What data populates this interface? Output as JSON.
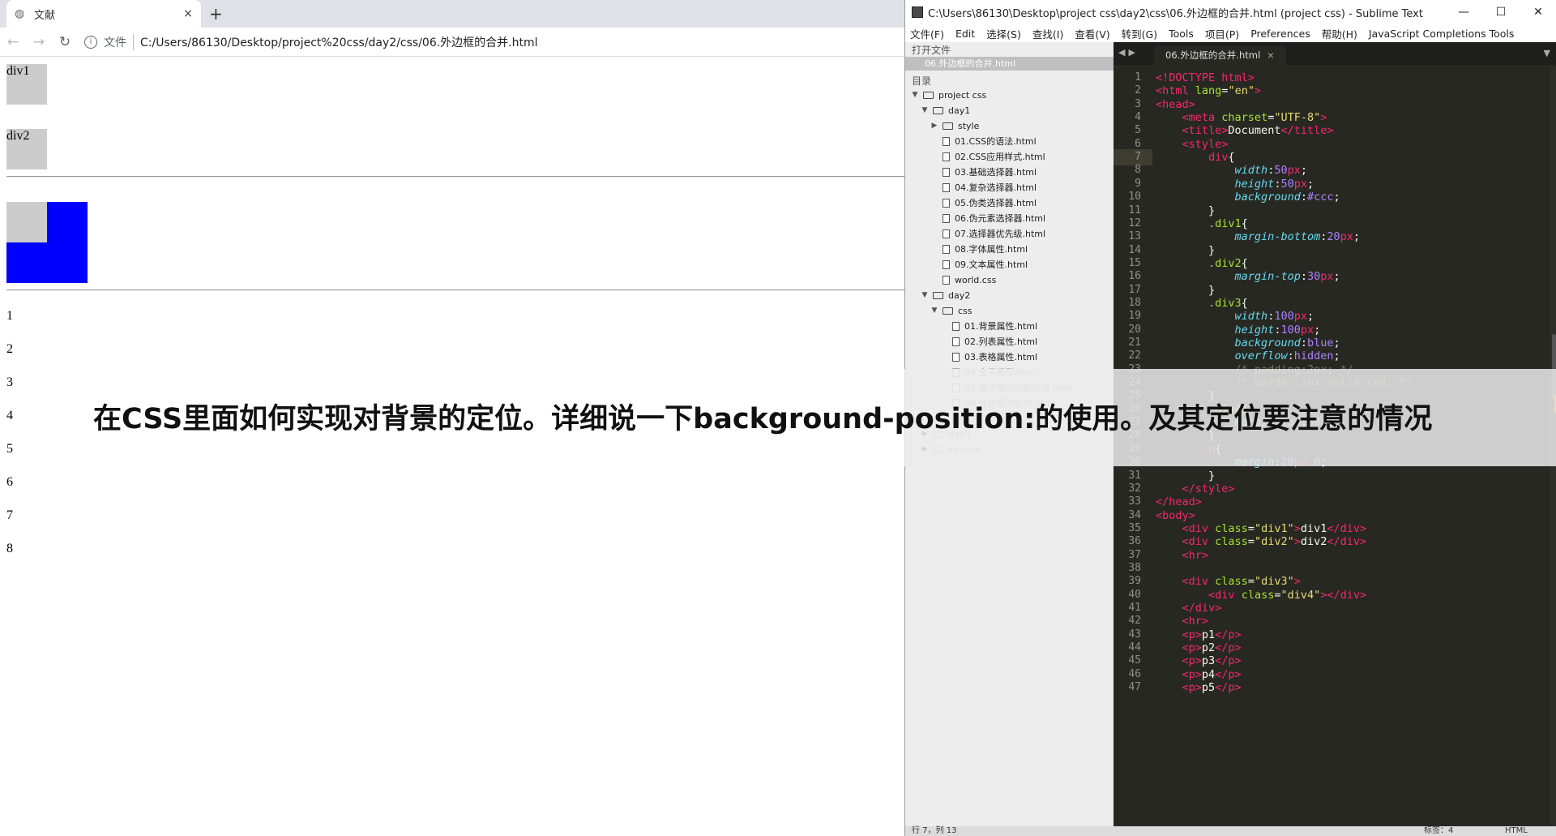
{
  "browser": {
    "tab_title": "文献",
    "new_tab": "+",
    "tab_close": "×",
    "nav": {
      "back": "←",
      "forward": "→",
      "reload": "↻"
    },
    "omnibox": {
      "info_icon": "i",
      "scheme": "文件",
      "url": "C:/Users/86130/Desktop/project%20css/day2/css/06.外边框的合并.html"
    },
    "content": {
      "div1": "div1",
      "div2": "div2",
      "paragraphs": [
        "1",
        "2",
        "3",
        "4",
        "5",
        "6",
        "7",
        "8"
      ]
    }
  },
  "sublime": {
    "title": "C:\\Users\\86130\\Desktop\\project css\\day2\\css\\06.外边框的合并.html (project css) - Sublime Text",
    "window_controls": {
      "minimize": "—",
      "maximize": "☐",
      "close": "✕"
    },
    "menu": [
      "文件(F)",
      "Edit",
      "选择(S)",
      "查找(I)",
      "查看(V)",
      "转到(G)",
      "Tools",
      "项目(P)",
      "Preferences",
      "帮助(H)",
      "JavaScript Completions Tools"
    ],
    "sidebar": {
      "open_files_header": "打开文件",
      "open_file": "06.外边框的合并.html",
      "folders_header": "目录",
      "tree": [
        {
          "label": "project css",
          "type": "folder",
          "level": 0,
          "open": true
        },
        {
          "label": "day1",
          "type": "folder",
          "level": 1,
          "open": true
        },
        {
          "label": "style",
          "type": "folder",
          "level": 2,
          "open": false
        },
        {
          "label": "01.CSS的语法.html",
          "type": "file",
          "level": 2
        },
        {
          "label": "02.CSS应用样式.html",
          "type": "file",
          "level": 2
        },
        {
          "label": "03.基础选择器.html",
          "type": "file",
          "level": 2
        },
        {
          "label": "04.复杂选择器.html",
          "type": "file",
          "level": 2
        },
        {
          "label": "05.伪类选择器.html",
          "type": "file",
          "level": 2
        },
        {
          "label": "06.伪元素选择器.html",
          "type": "file",
          "level": 2
        },
        {
          "label": "07.选择器优先级.html",
          "type": "file",
          "level": 2
        },
        {
          "label": "08.字体属性.html",
          "type": "file",
          "level": 2
        },
        {
          "label": "09.文本属性.html",
          "type": "file",
          "level": 2
        },
        {
          "label": "world.css",
          "type": "file",
          "level": 2
        },
        {
          "label": "day2",
          "type": "folder",
          "level": 1,
          "open": true
        },
        {
          "label": "css",
          "type": "folder",
          "level": 2,
          "open": true
        },
        {
          "label": "01.背景属性.html",
          "type": "file",
          "level": 3
        },
        {
          "label": "02.列表属性.html",
          "type": "file",
          "level": 3
        },
        {
          "label": "03.表格属性.html",
          "type": "file",
          "level": 3
        },
        {
          "label": "04.盒子模型.html",
          "type": "file",
          "level": 3,
          "faded": true
        },
        {
          "label": "05.盒子模型的默认值.html",
          "type": "file",
          "level": 3,
          "faded": true
        },
        {
          "label": "06.外边框的合并.html",
          "type": "file",
          "level": 3,
          "faded": true
        },
        {
          "label": "",
          "type": "file",
          "level": 3,
          "faded": true
        },
        {
          "label": "day3",
          "type": "folder",
          "level": 1,
          "open": false,
          "faded": true
        },
        {
          "label": "images",
          "type": "folder",
          "level": 1,
          "open": false,
          "faded": true
        }
      ]
    },
    "editor_tab": "06.外边框的合并.html",
    "tab_close": "×",
    "line_numbers": [
      "1",
      "2",
      "3",
      "4",
      "5",
      "6",
      "7",
      "8",
      "9",
      "10",
      "11",
      "12",
      "13",
      "14",
      "15",
      "16",
      "17",
      "18",
      "19",
      "20",
      "21",
      "22",
      "23",
      "24",
      "25",
      "26",
      "27",
      "28",
      "29",
      "30",
      "31",
      "32",
      "33",
      "34",
      "35",
      "36",
      "37",
      "38",
      "39",
      "40",
      "41",
      "42",
      "43",
      "44",
      "45",
      "46",
      "47"
    ],
    "status_left": "行 7，列 13",
    "status_tab": "标签：4",
    "status_syntax": "HTML"
  },
  "overlay": {
    "text": "在CSS里面如何实现对背景的定位。详细说一下background-position:的使用。及其定位要注意的情况"
  },
  "colors": {
    "blue_box": "#0000ff",
    "gray_box": "#cccccc",
    "editor_bg": "#272822"
  }
}
